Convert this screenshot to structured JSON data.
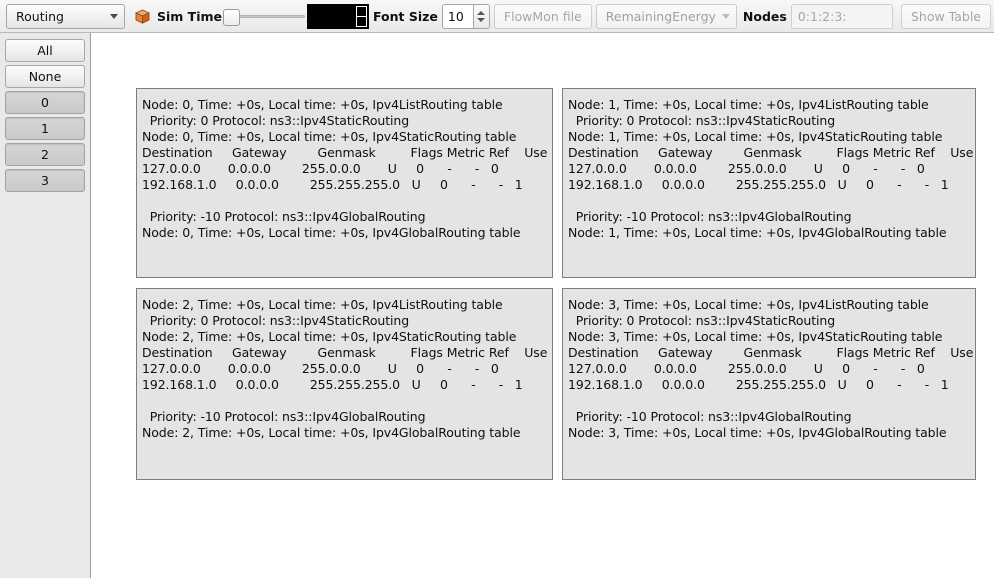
{
  "toolbar": {
    "mode_combo": {
      "value": "Routing",
      "icon": "cube-icon"
    },
    "sim_time_label": "Sim Time",
    "sim_time_value": "",
    "font_size_label": "Font Size",
    "font_size_value": "10",
    "flowmon_file_label": "FlowMon file",
    "remaining_energy_label": "RemainingEnergy",
    "nodes_label": "Nodes",
    "nodes_value": "0:1:2:3:",
    "show_table_label": "Show Table"
  },
  "sidebar": {
    "buttons": [
      {
        "label": "All",
        "pressed": false
      },
      {
        "label": "None",
        "pressed": false
      },
      {
        "label": "0",
        "pressed": true
      },
      {
        "label": "1",
        "pressed": true
      },
      {
        "label": "2",
        "pressed": true
      },
      {
        "label": "3",
        "pressed": true
      }
    ]
  },
  "panels": [
    {
      "node": "0",
      "lines": [
        "Node: 0, Time: +0s, Local time: +0s, Ipv4ListRouting table",
        "  Priority: 0 Protocol: ns3::Ipv4StaticRouting",
        "Node: 0, Time: +0s, Local time: +0s, Ipv4StaticRouting table",
        "Destination     Gateway        Genmask         Flags Metric Ref    Use Iface",
        "127.0.0.0       0.0.0.0        255.0.0.0       U     0      -      -   0",
        "192.168.1.0     0.0.0.0        255.255.255.0   U     0      -      -   1",
        "",
        "  Priority: -10 Protocol: ns3::Ipv4GlobalRouting",
        "Node: 0, Time: +0s, Local time: +0s, Ipv4GlobalRouting table"
      ]
    },
    {
      "node": "1",
      "lines": [
        "Node: 1, Time: +0s, Local time: +0s, Ipv4ListRouting table",
        "  Priority: 0 Protocol: ns3::Ipv4StaticRouting",
        "Node: 1, Time: +0s, Local time: +0s, Ipv4StaticRouting table",
        "Destination     Gateway        Genmask         Flags Metric Ref    Use Iface",
        "127.0.0.0       0.0.0.0        255.0.0.0       U     0      -      -   0",
        "192.168.1.0     0.0.0.0        255.255.255.0   U     0      -      -   1",
        "",
        "  Priority: -10 Protocol: ns3::Ipv4GlobalRouting",
        "Node: 1, Time: +0s, Local time: +0s, Ipv4GlobalRouting table"
      ]
    },
    {
      "node": "2",
      "lines": [
        "Node: 2, Time: +0s, Local time: +0s, Ipv4ListRouting table",
        "  Priority: 0 Protocol: ns3::Ipv4StaticRouting",
        "Node: 2, Time: +0s, Local time: +0s, Ipv4StaticRouting table",
        "Destination     Gateway        Genmask         Flags Metric Ref    Use Iface",
        "127.0.0.0       0.0.0.0        255.0.0.0       U     0      -      -   0",
        "192.168.1.0     0.0.0.0        255.255.255.0   U     0      -      -   1",
        "",
        "  Priority: -10 Protocol: ns3::Ipv4GlobalRouting",
        "Node: 2, Time: +0s, Local time: +0s, Ipv4GlobalRouting table"
      ]
    },
    {
      "node": "3",
      "lines": [
        "Node: 3, Time: +0s, Local time: +0s, Ipv4ListRouting table",
        "  Priority: 0 Protocol: ns3::Ipv4StaticRouting",
        "Node: 3, Time: +0s, Local time: +0s, Ipv4StaticRouting table",
        "Destination     Gateway        Genmask         Flags Metric Ref    Use Iface",
        "127.0.0.0       0.0.0.0        255.0.0.0       U     0      -      -   0",
        "192.168.1.0     0.0.0.0        255.255.255.0   U     0      -      -   1",
        "",
        "  Priority: -10 Protocol: ns3::Ipv4GlobalRouting",
        "Node: 3, Time: +0s, Local time: +0s, Ipv4GlobalRouting table"
      ]
    }
  ],
  "colors": {
    "toolbar_bg": "#efefef",
    "sidebar_bg": "#e9e9e9",
    "panel_bg": "#e4e4e4",
    "panel_border": "#7d7d7d",
    "canvas_bg": "#ffffff",
    "time_display_bg": "#000000",
    "cube_icon": "#e8843a"
  }
}
